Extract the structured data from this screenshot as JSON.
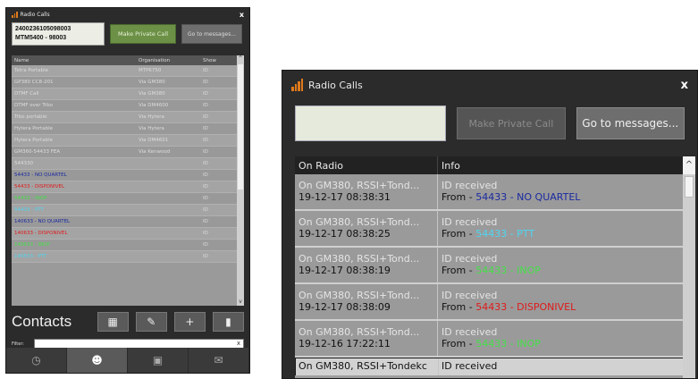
{
  "colors": {
    "blue": "#1b2aa0",
    "cyan": "#4fd6f2",
    "green": "#46e04a",
    "red": "#e01a1a",
    "accent": "#e07a1c"
  },
  "left": {
    "title": "Radio Calls",
    "close": "x",
    "id_line1": "2400236105098003",
    "id_line2": "MTM5400 - 98003",
    "make_private_call": "Make Private Call",
    "go_to_messages": "Go to messages...",
    "columns": {
      "name": "Name",
      "organisation": "Organisation",
      "show": "Show"
    },
    "rows": [
      {
        "name": "Tetra Portable",
        "org": "MTP6750",
        "show": "ID",
        "color": ""
      },
      {
        "name": "GP380 CC8-201",
        "org": "Via GM380",
        "show": "ID",
        "color": ""
      },
      {
        "name": "DTMF Call",
        "org": "Via GM380",
        "show": "ID",
        "color": ""
      },
      {
        "name": "DTMF over Trbo",
        "org": "Via DM4600",
        "show": "ID",
        "color": ""
      },
      {
        "name": "Trbo portable",
        "org": "Via Hytera",
        "show": "ID",
        "color": ""
      },
      {
        "name": "Hytera Portable",
        "org": "Via Hytera",
        "show": "ID",
        "color": ""
      },
      {
        "name": "Hytera Portable",
        "org": "Via DM4601",
        "show": "ID",
        "color": ""
      },
      {
        "name": "GM360-54433 FEA",
        "org": "Via Kenwood",
        "show": "ID",
        "color": ""
      },
      {
        "name": "544330",
        "org": "",
        "show": "ID",
        "color": ""
      },
      {
        "name": "54433 - NO QUARTEL",
        "org": "",
        "show": "ID",
        "color": "#1b2aa0"
      },
      {
        "name": "54433 - DISPONIVEL",
        "org": "",
        "show": "ID",
        "color": "#e01a1a"
      },
      {
        "name": "54433 - INOP",
        "org": "",
        "show": "ID",
        "color": "#46e04a"
      },
      {
        "name": "54433 - PTT",
        "org": "",
        "show": "ID",
        "color": "#4fd6f2"
      },
      {
        "name": "140633 - NO QUARTEL",
        "org": "",
        "show": "ID",
        "color": "#1b2aa0"
      },
      {
        "name": "140633 - DISPONIVEL",
        "org": "",
        "show": "ID",
        "color": "#e01a1a"
      },
      {
        "name": "140633 - INOP",
        "org": "",
        "show": "ID",
        "color": "#46e04a"
      },
      {
        "name": "140633 - PTT",
        "org": "",
        "show": "ID",
        "color": "#4fd6f2"
      }
    ],
    "contacts_label": "Contacts",
    "filter_label": "Filter:",
    "filter_clear": "x"
  },
  "right": {
    "title": "Radio Calls",
    "close": "x",
    "make_private_call": "Make Private Call",
    "go_to_messages": "Go to messages...",
    "columns": {
      "on_radio": "On Radio",
      "info": "Info"
    },
    "rows": [
      {
        "radio": "On GM380, RSSI+Tond...",
        "time": "19-12-17  08:38:31",
        "info": "ID received",
        "from": "From  - ",
        "code": "54433 - NO QUARTEL",
        "color": "#1b2aa0"
      },
      {
        "radio": "On GM380, RSSI+Tond...",
        "time": "19-12-17  08:38:25",
        "info": "ID received",
        "from": "From  - ",
        "code": "54433 - PTT",
        "color": "#4fd6f2"
      },
      {
        "radio": "On GM380, RSSI+Tond...",
        "time": "19-12-17  08:38:19",
        "info": "ID received",
        "from": "From  - ",
        "code": "54433 - INOP",
        "color": "#46e04a"
      },
      {
        "radio": "On GM380, RSSI+Tond...",
        "time": "19-12-17  08:38:09",
        "info": "ID received",
        "from": "From  - ",
        "code": "54433 - DISPONIVEL",
        "color": "#e01a1a"
      },
      {
        "radio": "On GM380, RSSI+Tond...",
        "time": "19-12-16  17:22:11",
        "info": "ID received",
        "from": "From  - ",
        "code": "54433 - INOP",
        "color": "#46e04a"
      }
    ],
    "last_row": {
      "radio": "On GM380, RSSI+Tondekc",
      "info": "ID received"
    }
  }
}
